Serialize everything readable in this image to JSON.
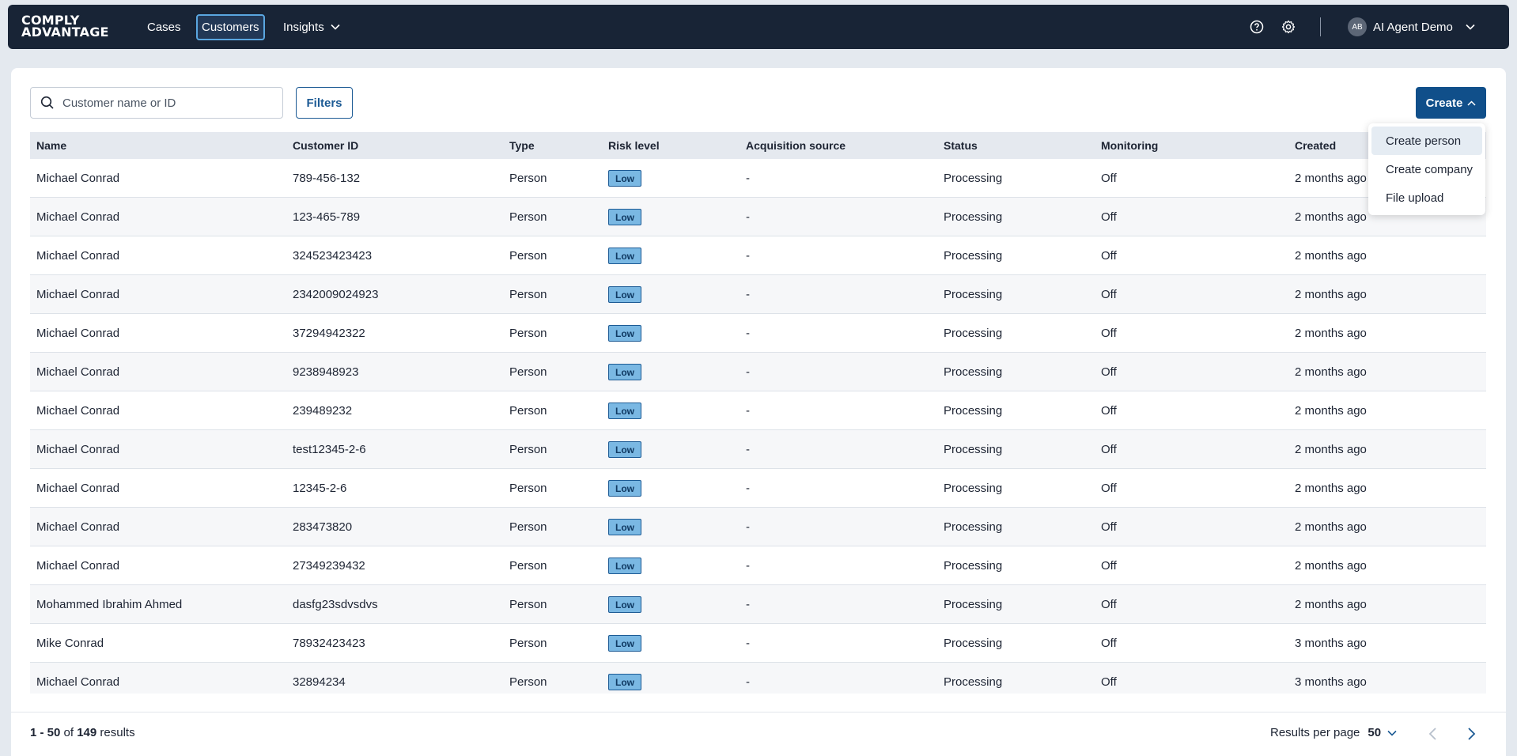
{
  "brand": {
    "line1": "COMPLY",
    "line2": "ADVANTAGE"
  },
  "nav": {
    "cases": "Cases",
    "customers": "Customers",
    "insights": "Insights"
  },
  "user": {
    "initials": "AB",
    "name": "AI Agent Demo"
  },
  "search": {
    "placeholder": "Customer name or ID",
    "value": ""
  },
  "toolbar": {
    "filters_label": "Filters",
    "create_label": "Create"
  },
  "create_menu": {
    "items": [
      "Create person",
      "Create company",
      "File upload"
    ],
    "highlighted": "Create person"
  },
  "table": {
    "headers": [
      "Name",
      "Customer ID",
      "Type",
      "Risk level",
      "Acquisition source",
      "Status",
      "Monitoring",
      "Created"
    ],
    "rows": [
      [
        "Michael Conrad",
        "789-456-132",
        "Person",
        "Low",
        "-",
        "Processing",
        "Off",
        "2 months ago"
      ],
      [
        "Michael Conrad",
        "123-465-789",
        "Person",
        "Low",
        "-",
        "Processing",
        "Off",
        "2 months ago"
      ],
      [
        "Michael Conrad",
        "324523423423",
        "Person",
        "Low",
        "-",
        "Processing",
        "Off",
        "2 months ago"
      ],
      [
        "Michael Conrad",
        "2342009024923",
        "Person",
        "Low",
        "-",
        "Processing",
        "Off",
        "2 months ago"
      ],
      [
        "Michael Conrad",
        "37294942322",
        "Person",
        "Low",
        "-",
        "Processing",
        "Off",
        "2 months ago"
      ],
      [
        "Michael Conrad",
        "9238948923",
        "Person",
        "Low",
        "-",
        "Processing",
        "Off",
        "2 months ago"
      ],
      [
        "Michael Conrad",
        "239489232",
        "Person",
        "Low",
        "-",
        "Processing",
        "Off",
        "2 months ago"
      ],
      [
        "Michael Conrad",
        "test12345-2-6",
        "Person",
        "Low",
        "-",
        "Processing",
        "Off",
        "2 months ago"
      ],
      [
        "Michael Conrad",
        "12345-2-6",
        "Person",
        "Low",
        "-",
        "Processing",
        "Off",
        "2 months ago"
      ],
      [
        "Michael Conrad",
        "283473820",
        "Person",
        "Low",
        "-",
        "Processing",
        "Off",
        "2 months ago"
      ],
      [
        "Michael Conrad",
        "27349239432",
        "Person",
        "Low",
        "-",
        "Processing",
        "Off",
        "2 months ago"
      ],
      [
        "Mohammed Ibrahim Ahmed",
        "dasfg23sdvsdvs",
        "Person",
        "Low",
        "-",
        "Processing",
        "Off",
        "2 months ago"
      ],
      [
        "Mike Conrad",
        "78932423423",
        "Person",
        "Low",
        "-",
        "Processing",
        "Off",
        "3 months ago"
      ],
      [
        "Michael Conrad",
        "32894234",
        "Person",
        "Low",
        "-",
        "Processing",
        "Off",
        "3 months ago"
      ]
    ]
  },
  "pagination": {
    "range": "1 - 50",
    "of_label": "of",
    "total": "149",
    "results_label": "results",
    "per_page_label": "Results per page",
    "per_page_value": "50"
  },
  "colors": {
    "topbar": "#182436",
    "primary": "#104f8a",
    "badge_low": "#7ab8e3"
  }
}
